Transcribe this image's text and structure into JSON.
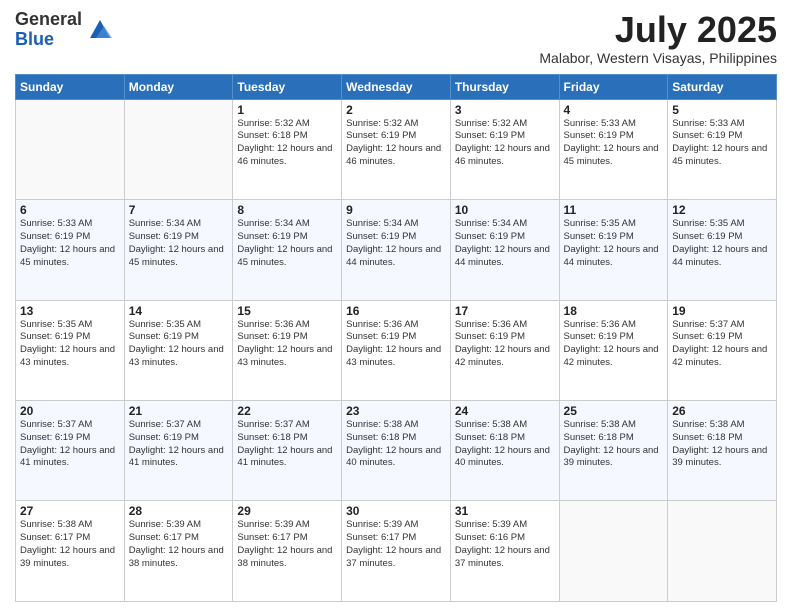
{
  "logo": {
    "general": "General",
    "blue": "Blue"
  },
  "title": "July 2025",
  "subtitle": "Malabor, Western Visayas, Philippines",
  "days_of_week": [
    "Sunday",
    "Monday",
    "Tuesday",
    "Wednesday",
    "Thursday",
    "Friday",
    "Saturday"
  ],
  "weeks": [
    [
      {
        "day": "",
        "info": ""
      },
      {
        "day": "",
        "info": ""
      },
      {
        "day": "1",
        "info": "Sunrise: 5:32 AM\nSunset: 6:18 PM\nDaylight: 12 hours and 46 minutes."
      },
      {
        "day": "2",
        "info": "Sunrise: 5:32 AM\nSunset: 6:19 PM\nDaylight: 12 hours and 46 minutes."
      },
      {
        "day": "3",
        "info": "Sunrise: 5:32 AM\nSunset: 6:19 PM\nDaylight: 12 hours and 46 minutes."
      },
      {
        "day": "4",
        "info": "Sunrise: 5:33 AM\nSunset: 6:19 PM\nDaylight: 12 hours and 45 minutes."
      },
      {
        "day": "5",
        "info": "Sunrise: 5:33 AM\nSunset: 6:19 PM\nDaylight: 12 hours and 45 minutes."
      }
    ],
    [
      {
        "day": "6",
        "info": "Sunrise: 5:33 AM\nSunset: 6:19 PM\nDaylight: 12 hours and 45 minutes."
      },
      {
        "day": "7",
        "info": "Sunrise: 5:34 AM\nSunset: 6:19 PM\nDaylight: 12 hours and 45 minutes."
      },
      {
        "day": "8",
        "info": "Sunrise: 5:34 AM\nSunset: 6:19 PM\nDaylight: 12 hours and 45 minutes."
      },
      {
        "day": "9",
        "info": "Sunrise: 5:34 AM\nSunset: 6:19 PM\nDaylight: 12 hours and 44 minutes."
      },
      {
        "day": "10",
        "info": "Sunrise: 5:34 AM\nSunset: 6:19 PM\nDaylight: 12 hours and 44 minutes."
      },
      {
        "day": "11",
        "info": "Sunrise: 5:35 AM\nSunset: 6:19 PM\nDaylight: 12 hours and 44 minutes."
      },
      {
        "day": "12",
        "info": "Sunrise: 5:35 AM\nSunset: 6:19 PM\nDaylight: 12 hours and 44 minutes."
      }
    ],
    [
      {
        "day": "13",
        "info": "Sunrise: 5:35 AM\nSunset: 6:19 PM\nDaylight: 12 hours and 43 minutes."
      },
      {
        "day": "14",
        "info": "Sunrise: 5:35 AM\nSunset: 6:19 PM\nDaylight: 12 hours and 43 minutes."
      },
      {
        "day": "15",
        "info": "Sunrise: 5:36 AM\nSunset: 6:19 PM\nDaylight: 12 hours and 43 minutes."
      },
      {
        "day": "16",
        "info": "Sunrise: 5:36 AM\nSunset: 6:19 PM\nDaylight: 12 hours and 43 minutes."
      },
      {
        "day": "17",
        "info": "Sunrise: 5:36 AM\nSunset: 6:19 PM\nDaylight: 12 hours and 42 minutes."
      },
      {
        "day": "18",
        "info": "Sunrise: 5:36 AM\nSunset: 6:19 PM\nDaylight: 12 hours and 42 minutes."
      },
      {
        "day": "19",
        "info": "Sunrise: 5:37 AM\nSunset: 6:19 PM\nDaylight: 12 hours and 42 minutes."
      }
    ],
    [
      {
        "day": "20",
        "info": "Sunrise: 5:37 AM\nSunset: 6:19 PM\nDaylight: 12 hours and 41 minutes."
      },
      {
        "day": "21",
        "info": "Sunrise: 5:37 AM\nSunset: 6:19 PM\nDaylight: 12 hours and 41 minutes."
      },
      {
        "day": "22",
        "info": "Sunrise: 5:37 AM\nSunset: 6:18 PM\nDaylight: 12 hours and 41 minutes."
      },
      {
        "day": "23",
        "info": "Sunrise: 5:38 AM\nSunset: 6:18 PM\nDaylight: 12 hours and 40 minutes."
      },
      {
        "day": "24",
        "info": "Sunrise: 5:38 AM\nSunset: 6:18 PM\nDaylight: 12 hours and 40 minutes."
      },
      {
        "day": "25",
        "info": "Sunrise: 5:38 AM\nSunset: 6:18 PM\nDaylight: 12 hours and 39 minutes."
      },
      {
        "day": "26",
        "info": "Sunrise: 5:38 AM\nSunset: 6:18 PM\nDaylight: 12 hours and 39 minutes."
      }
    ],
    [
      {
        "day": "27",
        "info": "Sunrise: 5:38 AM\nSunset: 6:17 PM\nDaylight: 12 hours and 39 minutes."
      },
      {
        "day": "28",
        "info": "Sunrise: 5:39 AM\nSunset: 6:17 PM\nDaylight: 12 hours and 38 minutes."
      },
      {
        "day": "29",
        "info": "Sunrise: 5:39 AM\nSunset: 6:17 PM\nDaylight: 12 hours and 38 minutes."
      },
      {
        "day": "30",
        "info": "Sunrise: 5:39 AM\nSunset: 6:17 PM\nDaylight: 12 hours and 37 minutes."
      },
      {
        "day": "31",
        "info": "Sunrise: 5:39 AM\nSunset: 6:16 PM\nDaylight: 12 hours and 37 minutes."
      },
      {
        "day": "",
        "info": ""
      },
      {
        "day": "",
        "info": ""
      }
    ]
  ]
}
